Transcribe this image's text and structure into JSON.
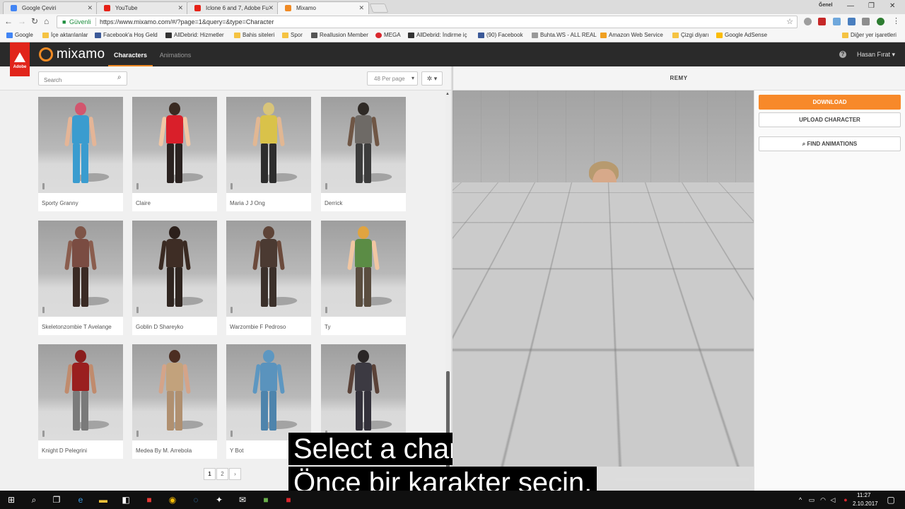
{
  "browser": {
    "tabs": [
      {
        "label": "Google Çeviri",
        "color": "#4285f4"
      },
      {
        "label": "YouTube",
        "color": "#e62117"
      },
      {
        "label": "Iclone 6 and 7, Adobe Fu",
        "color": "#e62117"
      },
      {
        "label": "Mixamo",
        "color": "#f08a24"
      }
    ],
    "profile": "Ğenel",
    "secure_label": "Güvenli",
    "url": "https://www.mixamo.com/#/?page=1&query=&type=Character",
    "bookmarks": [
      {
        "label": "Google",
        "color": "#4285f4"
      },
      {
        "label": "İçe aktarılanlar",
        "color": "#f5c342"
      },
      {
        "label": "Facebook'a Hoş Geld",
        "color": "#3b5998"
      },
      {
        "label": "AllDebrid: Hizmetler",
        "color": "#333333"
      },
      {
        "label": "Bahis siteleri",
        "color": "#f5c342"
      },
      {
        "label": "Spor",
        "color": "#f5c342"
      },
      {
        "label": "Reallusion Member",
        "color": "#555555"
      },
      {
        "label": "MEGA",
        "color": "#d9272e"
      },
      {
        "label": "AllDebrid: İndirme iç",
        "color": "#333333"
      },
      {
        "label": "(90) Facebook",
        "color": "#3b5998"
      },
      {
        "label": "Buhta.WS - ALL REAL",
        "color": "#999999"
      },
      {
        "label": "Amazon Web Service",
        "color": "#f0a020"
      },
      {
        "label": "Çizgi diyarı",
        "color": "#f5c342"
      },
      {
        "label": "Google AdSense",
        "color": "#fbbc05"
      },
      {
        "label": "Diğer yer işaretleri",
        "color": "#f5c342"
      }
    ]
  },
  "header": {
    "brand_badge": "Adobe",
    "app_name": "mixamo",
    "nav": {
      "characters": "Characters",
      "animations": "Animations"
    },
    "user": "Hasan Fırat"
  },
  "left": {
    "search_placeholder": "Search",
    "per_page": "48 Per page",
    "characters": [
      {
        "name": "Sporty Granny",
        "hair": "#d2566e",
        "skin": "#e4b597",
        "top": "#3a9ccf",
        "legs": "#3a9ccf"
      },
      {
        "name": "Claire",
        "hair": "#3a2b22",
        "skin": "#f0c7a6",
        "top": "#d91f2a",
        "legs": "#2a2220"
      },
      {
        "name": "Maria J J Ong",
        "hair": "#d8c47a",
        "skin": "#e1b793",
        "top": "#d9c24a",
        "legs": "#2d2d2d"
      },
      {
        "name": "Derrick",
        "hair": "#2f2a26",
        "skin": "#6f5645",
        "top": "#6e6a66",
        "legs": "#3c3c3c"
      },
      {
        "name": "Skeletonzombie T Avelange",
        "hair": "#7e5548",
        "skin": "#8a5d4e",
        "top": "#7a4c42",
        "legs": "#3a2a24"
      },
      {
        "name": "Goblin D Shareyko",
        "hair": "#2c201b",
        "skin": "#3a2a22",
        "top": "#3e2d25",
        "legs": "#2f2520"
      },
      {
        "name": "Warzombie F Pedroso",
        "hair": "#5e4438",
        "skin": "#6b4a3c",
        "top": "#4b3a32",
        "legs": "#3b302a"
      },
      {
        "name": "Ty",
        "hair": "#e0a440",
        "skin": "#f0c6a2",
        "top": "#5b8c45",
        "legs": "#5a4d3f"
      },
      {
        "name": "Knight D Pelegrini",
        "hair": "#8a1e1e",
        "skin": "#c08b6d",
        "top": "#9a1f1f",
        "legs": "#7a7a7a"
      },
      {
        "name": "Medea By M. Arrebola",
        "hair": "#4c2e22",
        "skin": "#d4a489",
        "top": "#c2a27c",
        "legs": "#b09070"
      },
      {
        "name": "Y Bot",
        "hair": "#5d97c1",
        "skin": "#5d97c1",
        "top": "#5a93bd",
        "legs": "#4e84ac"
      },
      {
        "name": "",
        "hair": "#2a2626",
        "skin": "#5a4238",
        "top": "#3c3a42",
        "legs": "#33313a"
      }
    ],
    "pages": [
      "1",
      "2",
      "›"
    ]
  },
  "viewer": {
    "character_title": "REMY",
    "buttons": {
      "download": "DOWNLOAD",
      "upload": "UPLOAD CHARACTER",
      "find": "FIND ANIMATIONS"
    }
  },
  "subtitles": {
    "line1": "Select a character first.",
    "line2": "Önce bir karakter seçin."
  },
  "taskbar": {
    "time": "11:27",
    "date": "2.10.2017"
  }
}
